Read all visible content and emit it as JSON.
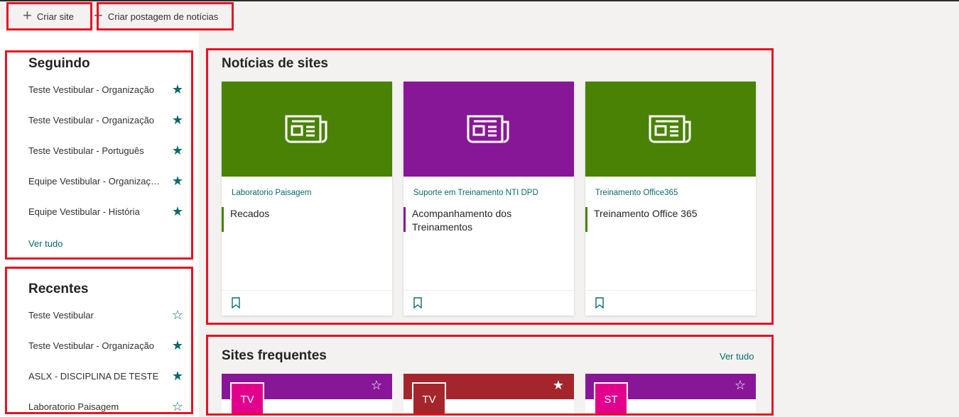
{
  "toolbar": {
    "create_site_label": "Criar site",
    "create_news_label": "Criar postagem de notícias"
  },
  "following": {
    "title": "Seguindo",
    "items": [
      {
        "label": "Teste Vestibular - Organização",
        "starred": true
      },
      {
        "label": "Teste Vestibular - Organização",
        "starred": true
      },
      {
        "label": "Teste Vestibular - Português",
        "starred": true
      },
      {
        "label": "Equipe Vestibular - Organização",
        "starred": true
      },
      {
        "label": "Equipe Vestibular - História",
        "starred": true
      }
    ],
    "see_all": "Ver tudo"
  },
  "recent": {
    "title": "Recentes",
    "items": [
      {
        "label": "Teste Vestibular",
        "starred": false
      },
      {
        "label": "Teste Vestibular - Organização",
        "starred": true
      },
      {
        "label": "ASLX - DISCIPLINA DE TESTE",
        "starred": true
      },
      {
        "label": "Laboratorio Paisagem",
        "starred": false
      }
    ]
  },
  "news": {
    "title": "Notícias de sites",
    "cards": [
      {
        "site": "Laboratorio Paisagem",
        "headline": "Recados",
        "color": "#498205"
      },
      {
        "site": "Suporte em Treinamento NTI DPD",
        "headline": "Acompanhamento dos Treinamentos",
        "color": "#881798"
      },
      {
        "site": "Treinamento Office365",
        "headline": "Treinamento Office 365",
        "color": "#498205"
      }
    ]
  },
  "frequent": {
    "title": "Sites frequentes",
    "see_all": "Ver tudo",
    "cards": [
      {
        "initials": "TV",
        "color": "#881798",
        "mono_color": "#e3008c",
        "starred": false
      },
      {
        "initials": "TV",
        "color": "#a4262c",
        "mono_color": "#a4262c",
        "starred": true
      },
      {
        "initials": "ST",
        "color": "#881798",
        "mono_color": "#e3008c",
        "starred": false
      }
    ]
  },
  "colors": {
    "accent": "#0b6a6a",
    "highlight": "#e81123"
  }
}
